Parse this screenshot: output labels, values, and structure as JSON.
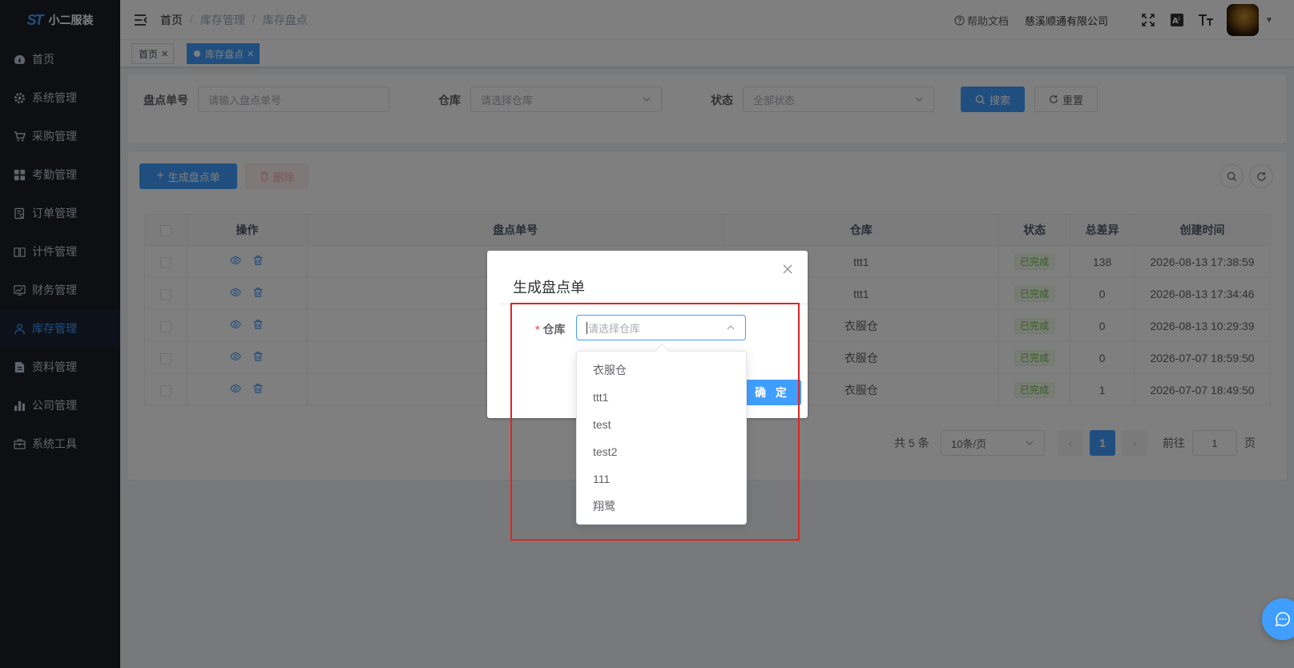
{
  "app": {
    "name": "小二服装",
    "logo_text": "ST"
  },
  "sidebar": {
    "items": [
      {
        "label": "首页",
        "icon": "dashboard-icon"
      },
      {
        "label": "系统管理",
        "icon": "gear-icon"
      },
      {
        "label": "采购管理",
        "icon": "cart-icon"
      },
      {
        "label": "考勤管理",
        "icon": "grid-icon"
      },
      {
        "label": "订单管理",
        "icon": "order-icon"
      },
      {
        "label": "计件管理",
        "icon": "book-icon"
      },
      {
        "label": "财务管理",
        "icon": "chart-icon"
      },
      {
        "label": "库存管理",
        "icon": "user-icon",
        "active": true
      },
      {
        "label": "资料管理",
        "icon": "document-icon"
      },
      {
        "label": "公司管理",
        "icon": "bar-chart-icon"
      },
      {
        "label": "系统工具",
        "icon": "toolbox-icon"
      }
    ]
  },
  "navbar": {
    "breadcrumb": [
      "首页",
      "库存管理",
      "库存盘点"
    ],
    "help": "帮助文档",
    "company": "慈溪顺通有限公司"
  },
  "tags": [
    {
      "label": "首页",
      "active": false
    },
    {
      "label": "库存盘点",
      "active": true
    }
  ],
  "search": {
    "code_label": "盘点单号",
    "code_placeholder": "请输入盘点单号",
    "warehouse_label": "仓库",
    "warehouse_placeholder": "请选择仓库",
    "status_label": "状态",
    "status_placeholder": "全部状态",
    "search_btn": "搜索",
    "reset_btn": "重置"
  },
  "toolbar": {
    "create_btn": "生成盘点单",
    "delete_btn": "删除"
  },
  "table": {
    "headers": [
      "操作",
      "盘点单号",
      "仓库",
      "状态",
      "总差异",
      "创建时间"
    ],
    "rows": [
      {
        "warehouse": "ttt1",
        "status": "已完成",
        "diff": "138",
        "created": "2026-08-13 17:38:59"
      },
      {
        "warehouse": "ttt1",
        "status": "已完成",
        "diff": "0",
        "created": "2026-08-13 17:34:46"
      },
      {
        "warehouse": "衣服仓",
        "status": "已完成",
        "diff": "0",
        "created": "2026-08-13 10:29:39"
      },
      {
        "warehouse": "衣服仓",
        "status": "已完成",
        "diff": "0",
        "created": "2026-07-07 18:59:50"
      },
      {
        "warehouse": "衣服仓",
        "status": "已完成",
        "diff": "1",
        "created": "2026-07-07 18:49:50"
      }
    ]
  },
  "pagination": {
    "total": "共 5 条",
    "page_size": "10条/页",
    "current": "1",
    "goto_label": "前往",
    "goto_value": "1",
    "page_unit": "页"
  },
  "dialog": {
    "title": "生成盘点单",
    "warehouse_label": "仓库",
    "required_mark": "*",
    "warehouse_placeholder": "请选择仓库",
    "confirm_btn": "确 定",
    "options": [
      "衣服仓",
      "ttt1",
      "test",
      "test2",
      "111",
      "翔鹭"
    ]
  },
  "colors": {
    "primary": "#409eff",
    "sidebar_bg": "#1d1e25",
    "highlight": "#e02424",
    "success": "#67c23a"
  }
}
